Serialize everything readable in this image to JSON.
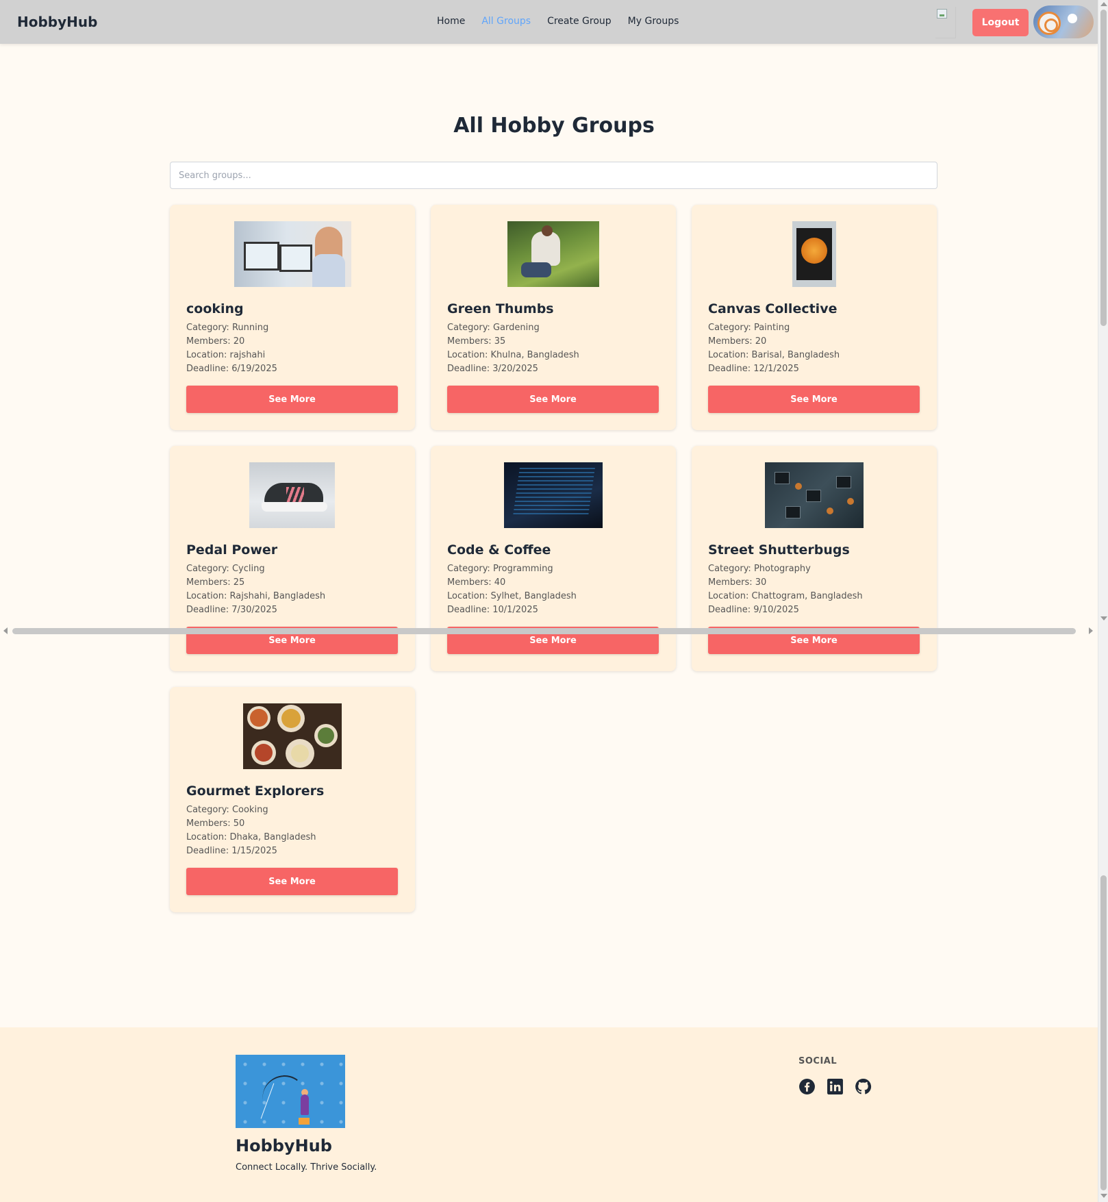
{
  "navbar": {
    "brand": "HobbyHub",
    "links": [
      {
        "label": "Home",
        "active": false
      },
      {
        "label": "All Groups",
        "active": true
      },
      {
        "label": "Create Group",
        "active": false
      },
      {
        "label": "My Groups",
        "active": false
      }
    ],
    "logout_label": "Logout"
  },
  "main": {
    "title": "All Hobby Groups",
    "search_placeholder": "Search groups...",
    "groups": [
      {
        "name": "cooking",
        "category": "Category: Running",
        "members": "Members: 20",
        "location": "Location: rajshahi",
        "deadline": "Deadline: 6/19/2025",
        "button": "See More"
      },
      {
        "name": "Green Thumbs",
        "category": "Category: Gardening",
        "members": "Members: 35",
        "location": "Location: Khulna, Bangladesh",
        "deadline": "Deadline: 3/20/2025",
        "button": "See More"
      },
      {
        "name": "Canvas Collective",
        "category": "Category: Painting",
        "members": "Members: 20",
        "location": "Location: Barisal, Bangladesh",
        "deadline": "Deadline: 12/1/2025",
        "button": "See More"
      },
      {
        "name": "Pedal Power",
        "category": "Category: Cycling",
        "members": "Members: 25",
        "location": "Location: Rajshahi, Bangladesh",
        "deadline": "Deadline: 7/30/2025",
        "button": "See More"
      },
      {
        "name": "Code & Coffee",
        "category": "Category: Programming",
        "members": "Members: 40",
        "location": "Location: Sylhet, Bangladesh",
        "deadline": "Deadline: 10/1/2025",
        "button": "See More"
      },
      {
        "name": "Street Shutterbugs",
        "category": "Category: Photography",
        "members": "Members: 30",
        "location": "Location: Chattogram, Bangladesh",
        "deadline": "Deadline: 9/10/2025",
        "button": "See More"
      },
      {
        "name": "Gourmet Explorers",
        "category": "Category: Cooking",
        "members": "Members: 50",
        "location": "Location: Dhaka, Bangladesh",
        "deadline": "Deadline: 1/15/2025",
        "button": "See More"
      }
    ]
  },
  "footer": {
    "brand": "HobbyHub",
    "tagline": "Connect Locally. Thrive Socially.",
    "social_title": "SOCIAL",
    "social_icons": [
      "facebook-icon",
      "linkedin-icon",
      "github-icon"
    ]
  },
  "colors": {
    "navbar_bg": "#d1d1d1",
    "accent": "#f76565",
    "active_link": "#60a5fa",
    "card_bg": "#fff1dd",
    "page_bg": "#fffaf3"
  }
}
